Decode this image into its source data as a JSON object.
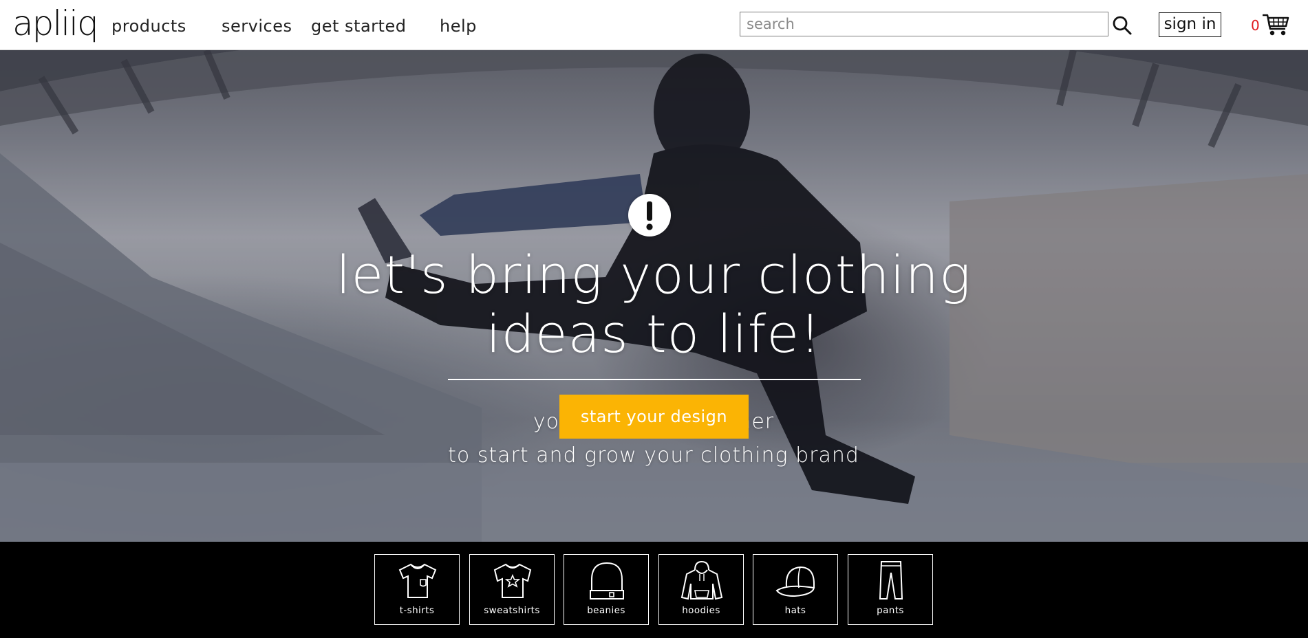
{
  "header": {
    "logo": "apliiq",
    "nav": [
      {
        "label": "products"
      },
      {
        "label": "services"
      },
      {
        "label": "get started"
      },
      {
        "label": "help"
      }
    ],
    "search": {
      "placeholder": "search",
      "icon": "search-icon"
    },
    "sign_in_label": "sign in",
    "cart": {
      "count": "0",
      "icon": "shopping-cart-icon",
      "count_color": "#e0191d"
    }
  },
  "hero": {
    "badge_icon": "exclamation-icon",
    "headline_line1": "let's bring your clothing",
    "headline_line2": "ideas to life!",
    "subtitle_line1": "your one-stop partner",
    "subtitle_line2": "to start and grow your clothing brand",
    "cta_label": "start your design",
    "cta_color": "#fbb404"
  },
  "categories": [
    {
      "label": "t-shirts",
      "icon": "t-shirt-icon"
    },
    {
      "label": "sweatshirts",
      "icon": "sweatshirt-icon"
    },
    {
      "label": "beanies",
      "icon": "beanie-icon"
    },
    {
      "label": "hoodies",
      "icon": "hoodie-icon"
    },
    {
      "label": "hats",
      "icon": "hat-icon"
    },
    {
      "label": "pants",
      "icon": "pants-icon"
    }
  ]
}
